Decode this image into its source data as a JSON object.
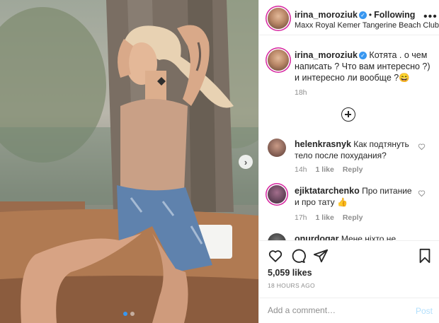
{
  "post": {
    "username": "irina_moroziuk",
    "follow_label": "Following",
    "location": "Maxx Royal Kemer Tangerine Beach Club",
    "caption_username": "irina_moroziuk",
    "caption_text": "Котята . о чем написать ? Что вам интересно ?) и интересно ли вообще ?😄",
    "caption_time": "18h",
    "likes": "5,059 likes",
    "posted_time": "18 HOURS AGO",
    "carousel_dots": 2,
    "active_dot": 0
  },
  "comments": [
    {
      "username": "helenkrasnyk",
      "text": "Как подтянуть тело после похудания?",
      "time": "14h",
      "likes": "1 like",
      "reply": "Reply"
    },
    {
      "username": "ejiktatarchenko",
      "text": "Про питание и про тату 👍",
      "time": "17h",
      "likes": "1 like",
      "reply": "Reply"
    },
    {
      "username": "onurdogar",
      "text": "Мене ніхто не"
    }
  ],
  "add_comment": {
    "placeholder": "Add a comment…",
    "post_label": "Post"
  },
  "icons": {
    "more": "more-horizontal-icon",
    "load_more": "plus-circle-icon",
    "like": "heart-icon",
    "comment": "comment-bubble-icon",
    "share": "paper-plane-icon",
    "save": "bookmark-icon",
    "next": "chevron-right-icon"
  },
  "colors": {
    "verified": "#3897f0",
    "link_disabled": "#b2dffc",
    "secondary_text": "#8e8e8e"
  }
}
